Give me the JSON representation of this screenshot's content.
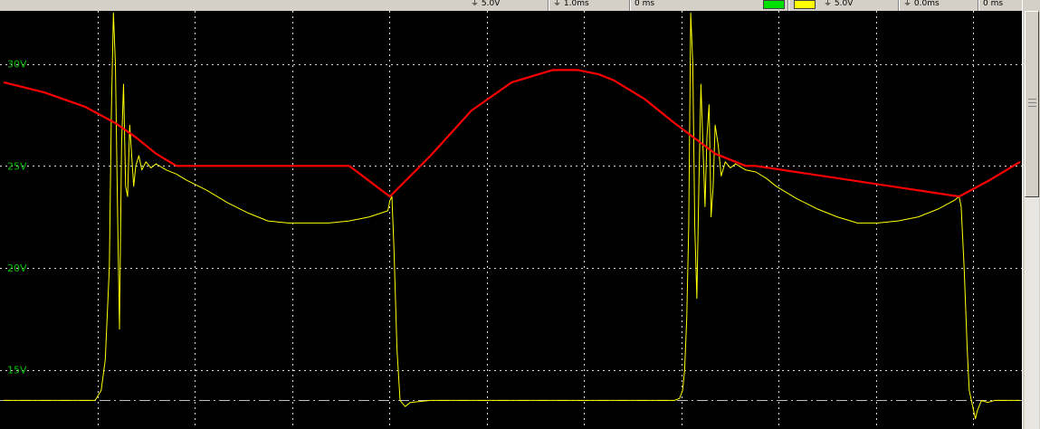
{
  "toolbar": {
    "items": [
      "5.0V",
      "1.0ms",
      "0 ms",
      "5.0V",
      "0.0ms",
      "0 ms"
    ],
    "channel_colors": {
      "ch1": "#00e000",
      "ch2": "#ffff00"
    }
  },
  "chart_data": {
    "type": "line",
    "xlim": [
      0,
      1
    ],
    "ylim": [
      12.1,
      32.6
    ],
    "y_ticks": [
      15,
      20,
      25,
      30
    ],
    "y_tick_labels": [
      "15V",
      "20V",
      "25V",
      "30V"
    ],
    "grid": true,
    "reference_level": 13.5,
    "series": [
      {
        "color": "#ffff00",
        "x": [
          0.0,
          0.04,
          0.07,
          0.09,
          0.096,
          0.1,
          0.104,
          0.106,
          0.108,
          0.11,
          0.112,
          0.114,
          0.116,
          0.118,
          0.12,
          0.122,
          0.124,
          0.126,
          0.128,
          0.13,
          0.133,
          0.136,
          0.14,
          0.145,
          0.15,
          0.16,
          0.17,
          0.18,
          0.2,
          0.22,
          0.24,
          0.26,
          0.28,
          0.3,
          0.32,
          0.34,
          0.36,
          0.372,
          0.378,
          0.38,
          0.382,
          0.384,
          0.387,
          0.39,
          0.395,
          0.4,
          0.42,
          0.45,
          0.5,
          0.55,
          0.6,
          0.63,
          0.65,
          0.66,
          0.665,
          0.668,
          0.67,
          0.672,
          0.674,
          0.676,
          0.678,
          0.68,
          0.682,
          0.684,
          0.686,
          0.688,
          0.69,
          0.692,
          0.694,
          0.696,
          0.698,
          0.7,
          0.703,
          0.706,
          0.71,
          0.715,
          0.72,
          0.73,
          0.74,
          0.75,
          0.76,
          0.78,
          0.8,
          0.82,
          0.84,
          0.86,
          0.88,
          0.9,
          0.92,
          0.935,
          0.94,
          0.942,
          0.945,
          0.948,
          0.95,
          0.953,
          0.956,
          0.958,
          0.962,
          0.968,
          0.975,
          0.985,
          1.0
        ],
        "y": [
          13.5,
          13.5,
          13.5,
          13.5,
          14.0,
          15.5,
          20.0,
          27.5,
          32.5,
          30.0,
          23.0,
          17.0,
          26.0,
          29.0,
          24.0,
          23.5,
          27.0,
          25.5,
          24.0,
          25.0,
          25.5,
          24.8,
          25.2,
          24.9,
          25.1,
          24.8,
          24.6,
          24.3,
          23.8,
          23.2,
          22.7,
          22.3,
          22.2,
          22.2,
          22.2,
          22.3,
          22.5,
          22.7,
          22.8,
          23.3,
          23.5,
          21.0,
          16.0,
          13.5,
          13.2,
          13.4,
          13.5,
          13.5,
          13.5,
          13.5,
          13.5,
          13.5,
          13.5,
          13.5,
          13.6,
          14.0,
          15.0,
          17.5,
          22.0,
          32.5,
          30.0,
          22.0,
          18.5,
          24.0,
          29.0,
          26.0,
          23.0,
          26.5,
          28.0,
          22.5,
          24.0,
          27.0,
          26.0,
          24.5,
          25.2,
          24.9,
          25.1,
          24.8,
          24.7,
          24.4,
          24.0,
          23.4,
          22.9,
          22.5,
          22.2,
          22.2,
          22.3,
          22.5,
          22.9,
          23.3,
          23.5,
          23.0,
          20.0,
          16.0,
          14.0,
          13.3,
          12.6,
          13.0,
          13.5,
          13.4,
          13.5,
          13.5,
          13.5
        ]
      },
      {
        "color": "#ff0000",
        "x": [
          0.0,
          0.04,
          0.08,
          0.11,
          0.13,
          0.15,
          0.17,
          0.18,
          0.22,
          0.29,
          0.34,
          0.38,
          0.42,
          0.46,
          0.5,
          0.54,
          0.565,
          0.585,
          0.6,
          0.63,
          0.66,
          0.7,
          0.73,
          0.74,
          0.94,
          0.97,
          1.0
        ],
        "y": [
          29.1,
          28.6,
          27.9,
          27.1,
          26.4,
          25.6,
          25.0,
          25.0,
          25.0,
          25.0,
          25.0,
          23.5,
          25.5,
          27.7,
          29.1,
          29.7,
          29.7,
          29.5,
          29.2,
          28.3,
          27.1,
          25.6,
          25.0,
          25.0,
          23.5,
          24.3,
          25.2
        ]
      }
    ]
  }
}
